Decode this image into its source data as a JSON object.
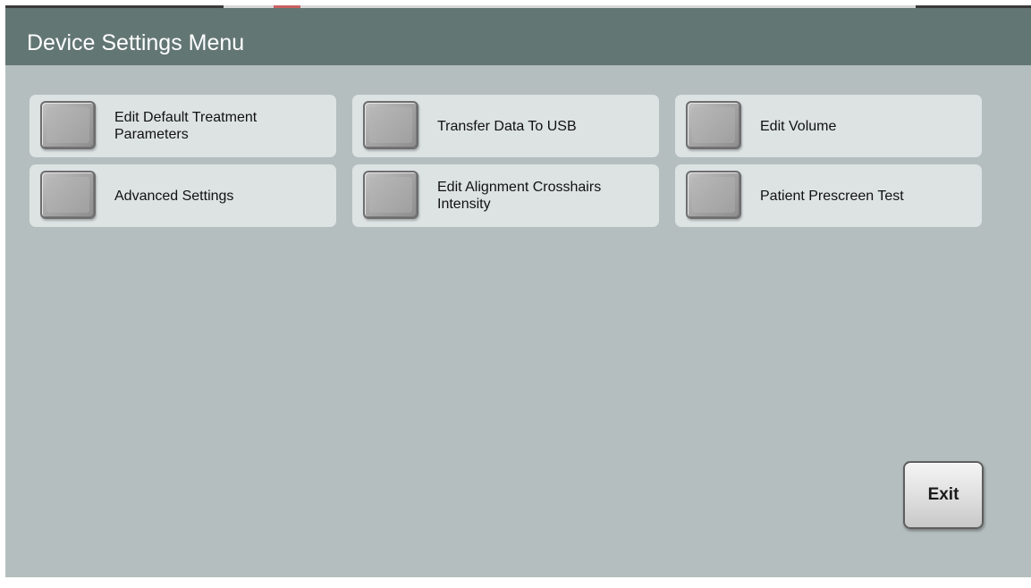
{
  "header": {
    "title": "Device Settings Menu"
  },
  "menu": {
    "items": [
      {
        "label": "Edit Default Treatment Parameters"
      },
      {
        "label": "Transfer Data To USB"
      },
      {
        "label": "Edit Volume"
      },
      {
        "label": "Advanced Settings"
      },
      {
        "label": "Edit Alignment Crosshairs Intensity"
      },
      {
        "label": "Patient Prescreen Test"
      }
    ]
  },
  "footer": {
    "exit_label": "Exit"
  },
  "colors": {
    "header_bg": "#627673",
    "screen_bg": "#b4bebe",
    "tile_bg": "#dde3e3"
  }
}
